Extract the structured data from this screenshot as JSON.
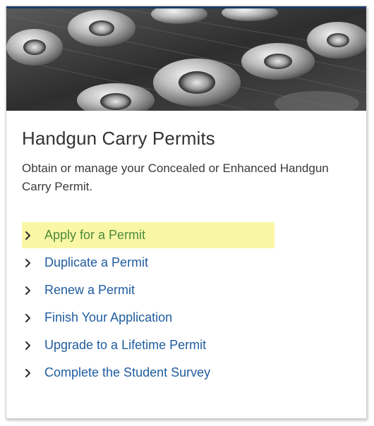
{
  "card": {
    "title": "Handgun Carry Permits",
    "description": "Obtain or manage your Concealed or Enhanced Handgun Carry Permit."
  },
  "links": [
    {
      "label": "Apply for a Permit",
      "highlighted": true
    },
    {
      "label": "Duplicate a Permit",
      "highlighted": false
    },
    {
      "label": "Renew a Permit",
      "highlighted": false
    },
    {
      "label": "Finish Your Application",
      "highlighted": false
    },
    {
      "label": "Upgrade to a Lifetime Permit",
      "highlighted": false
    },
    {
      "label": "Complete the Student Survey",
      "highlighted": false
    }
  ],
  "colors": {
    "top_bar": "#1f3a64",
    "link": "#1f5c9e",
    "highlight_bg": "#f9f7a6",
    "highlight_link": "#4f8a3c"
  },
  "icons": {
    "link_chevron": "chevron-right-icon"
  }
}
